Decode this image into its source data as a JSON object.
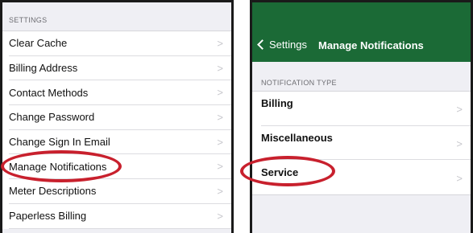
{
  "left_panel": {
    "section_header": "SETTINGS",
    "items": [
      {
        "label": "Clear Cache",
        "chevron": ">"
      },
      {
        "label": "Billing Address",
        "chevron": ">"
      },
      {
        "label": "Contact Methods",
        "chevron": ">"
      },
      {
        "label": "Change Password",
        "chevron": ">"
      },
      {
        "label": "Change Sign In Email",
        "chevron": ">"
      },
      {
        "label": "Manage Notifications",
        "chevron": ">"
      },
      {
        "label": "Meter Descriptions",
        "chevron": ">"
      },
      {
        "label": "Paperless Billing",
        "chevron": ">"
      }
    ]
  },
  "right_panel": {
    "nav": {
      "back_label": "Settings",
      "title": "Manage Notifications"
    },
    "section_header": "NOTIFICATION TYPE",
    "items": [
      {
        "label": "Billing",
        "chevron": ">"
      },
      {
        "label": "Miscellaneous",
        "chevron": ">"
      },
      {
        "label": "Service",
        "chevron": ">"
      }
    ]
  },
  "colors": {
    "nav_bar": "#1b6a36",
    "highlight": "#c8202d",
    "background": "#efeff4"
  },
  "icons": {
    "back": "chevron-left-icon",
    "row": "chevron-right-icon"
  }
}
